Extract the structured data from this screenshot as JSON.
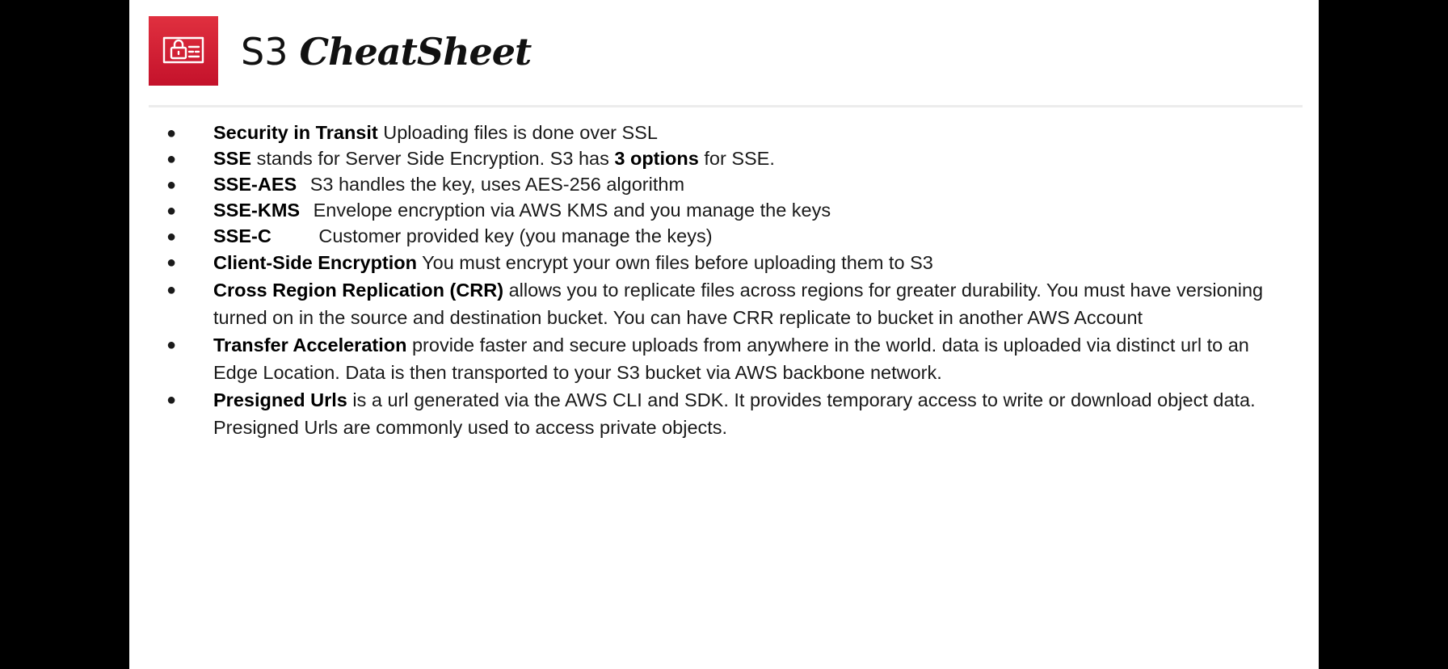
{
  "title": {
    "part1": "S3",
    "part2": "CheatSheet"
  },
  "logo": {
    "icon": "certificate-lock-icon",
    "background": "#d42a36"
  },
  "bullets": [
    {
      "term": "Security in Transit",
      "text": "Uploading files is done over SSL"
    },
    {
      "term": "SSE",
      "text_before": "stands for Server Side Encryption. S3 has",
      "emphasis": "3 options",
      "text_after": "for SSE."
    },
    {
      "term": "SSE-AES",
      "text": "S3 handles the key, uses AES-256 algorithm"
    },
    {
      "term": "SSE-KMS",
      "text": "Envelope encryption via AWS KMS and you manage the keys"
    },
    {
      "term": "SSE-C",
      "text": "Customer provided key (you manage the keys)"
    },
    {
      "term": "Client-Side Encryption",
      "text": "You must encrypt your own files before uploading them to S3"
    },
    {
      "term": "Cross Region Replication (CRR)",
      "text": "allows you to replicate files across regions for greater durability. You must have versioning turned on in the source and destination bucket. You can have CRR replicate to bucket in another AWS Account"
    },
    {
      "term": "Transfer Acceleration",
      "text": "provide faster and secure uploads from anywhere in the world. data is uploaded via distinct url to an Edge Location. Data is then transported to your S3 bucket via AWS backbone network."
    },
    {
      "term": "Presigned Urls",
      "text": "is a url generated via the AWS CLI and SDK. It provides temporary access to write or download object data. Presigned Urls are commonly used to access private objects."
    }
  ]
}
